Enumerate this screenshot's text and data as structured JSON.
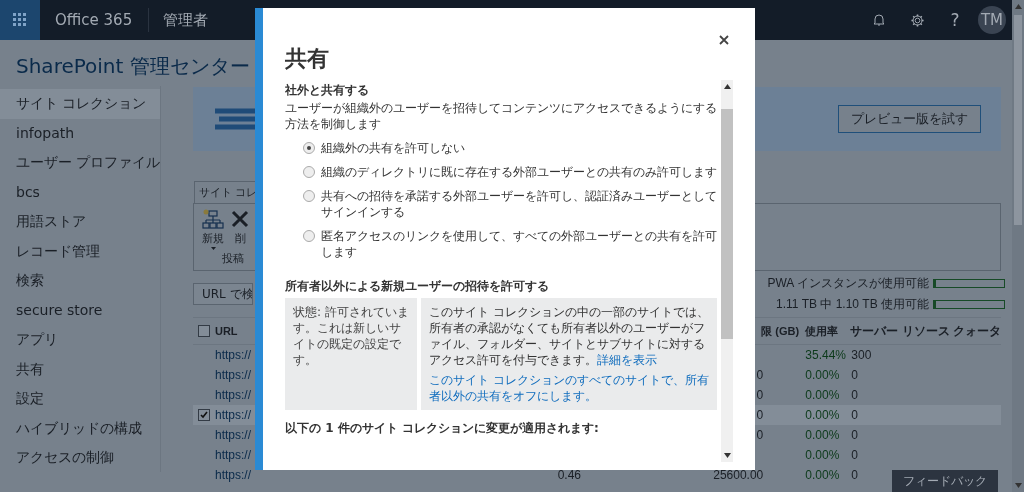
{
  "app_bar": {
    "brand": "Office 365",
    "section": "管理者",
    "help": "?",
    "avatar": "TM"
  },
  "page_title": "SharePoint 管理センター",
  "sidebar": {
    "items": [
      {
        "label": "サイト コレクション",
        "selected": true
      },
      {
        "label": "infopath",
        "selected": false
      },
      {
        "label": "ユーザー プロファイル",
        "selected": false
      },
      {
        "label": "bcs",
        "selected": false
      },
      {
        "label": "用語ストア",
        "selected": false
      },
      {
        "label": "レコード管理",
        "selected": false
      },
      {
        "label": "検索",
        "selected": false
      },
      {
        "label": "secure store",
        "selected": false
      },
      {
        "label": "アプリ",
        "selected": false
      },
      {
        "label": "共有",
        "selected": false
      },
      {
        "label": "設定",
        "selected": false
      },
      {
        "label": "ハイブリッドの構成",
        "selected": false
      },
      {
        "label": "アクセスの制御",
        "selected": false
      }
    ]
  },
  "banner": {
    "button": "プレビュー版を試す"
  },
  "ribbon": {
    "tab": "サイト コレ",
    "buttons": [
      {
        "label": "新規",
        "kind": "new"
      },
      {
        "label": "削",
        "kind": "delete"
      }
    ],
    "group": "投稿"
  },
  "search": {
    "placeholder": "URL で検"
  },
  "meters": [
    {
      "label": "PWA インスタンスが使用可能",
      "level": 0.03
    },
    {
      "label": "1.11 TB 中 1.10 TB 使用可能",
      "level": 0.03
    }
  ],
  "table": {
    "select_all_checked": false,
    "columns": {
      "url": "URL",
      "limit": "限 (GB)",
      "usage": "使用率",
      "quota": "サーバー リソース クォータ"
    },
    "rows": [
      {
        "url": "https://",
        "checked": false,
        "usage": "35.44%",
        "quota": "300"
      },
      {
        "url": "https://",
        "checked": false,
        "limit": "0",
        "usage": "0.00%",
        "quota": "0"
      },
      {
        "url": "https://",
        "checked": false,
        "limit": "0",
        "usage": "0.00%",
        "quota": "0"
      },
      {
        "url": "https://",
        "checked": true,
        "limit": "0",
        "usage": "0.00%",
        "quota": "0"
      },
      {
        "url": "https://",
        "checked": false,
        "limit": "0",
        "usage": "0.00%",
        "quota": "0"
      },
      {
        "url": "https://",
        "checked": false,
        "usage": "0.00%",
        "quota": "0"
      },
      {
        "url": "https://",
        "checked": false,
        "storage": "0.46",
        "limit": "25600.00",
        "usage": "0.00%",
        "quota": "0"
      }
    ]
  },
  "feedback": "フィードバック",
  "dialog": {
    "title": "共有",
    "external_sharing": {
      "heading": "社外と共有する",
      "description": "ユーザーが組織外のユーザーを招待してコンテンツにアクセスできるようにする方法を制御します",
      "options": [
        {
          "label": "組織外の共有を許可しない",
          "selected": true
        },
        {
          "label": "組織のディレクトリに既に存在する外部ユーザーとの共有のみ許可します",
          "selected": false
        },
        {
          "label": "共有への招待を承諾する外部ユーザーを許可し、認証済みユーザーとしてサインインする",
          "selected": false
        },
        {
          "label": "匿名アクセスのリンクを使用して、すべての外部ユーザーとの共有を許可します",
          "selected": false
        }
      ]
    },
    "invitations": {
      "heading": "所有者以外による新規ユーザーの招待を許可する",
      "status": "状態: 許可されています。これは新しいサイトの既定の設定です。",
      "info": "このサイト コレクションの中の一部のサイトでは、所有者の承認がなくても所有者以外のユーザーがファイル、フォルダー、サイトとサブサイトに対するアクセス許可を付与できます。",
      "info_link": "詳細を表示",
      "action_link": "このサイト コレクションのすべてのサイトで、所有者以外の共有をオフにします。"
    },
    "footer_note": "以下の 1 件のサイト コレクションに変更が適用されます:"
  }
}
